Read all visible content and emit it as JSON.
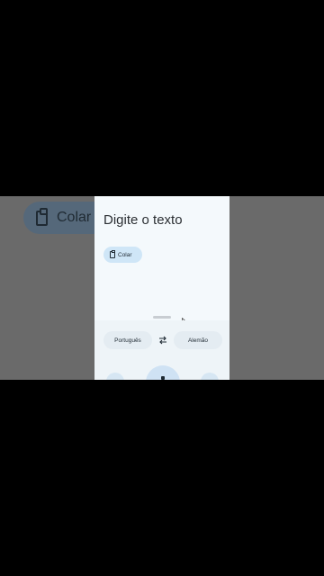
{
  "background_zoom": {
    "paste_label": "Colar"
  },
  "input": {
    "placeholder": "Digite o texto"
  },
  "paste_chip": {
    "label": "Colar"
  },
  "languages": {
    "source": "Português",
    "target": "Alemão"
  }
}
